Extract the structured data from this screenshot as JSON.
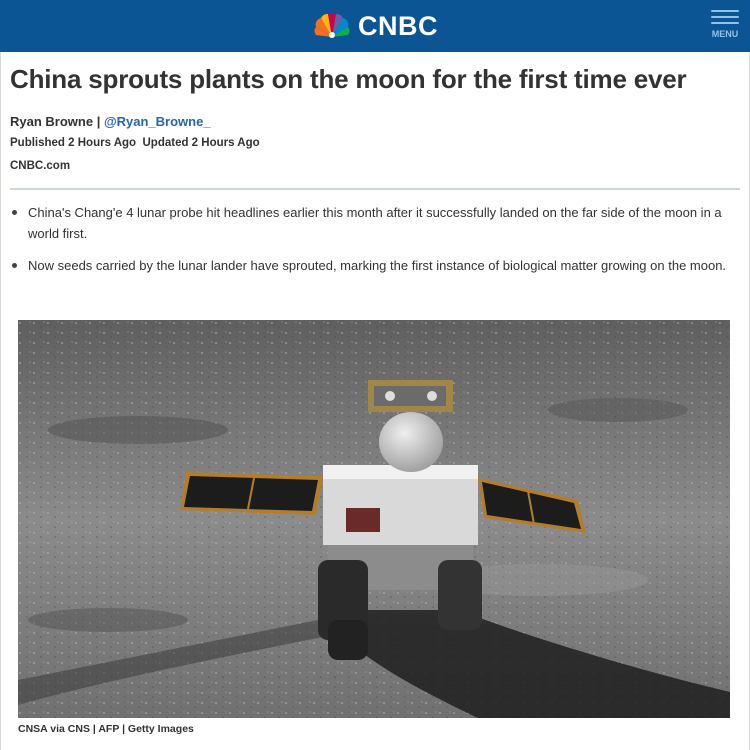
{
  "header": {
    "brand": "CNBC",
    "menu_label": "MENU",
    "background_color": "#0c5594"
  },
  "article": {
    "headline": "China sprouts plants on the moon for the first time ever",
    "author": "Ryan Browne",
    "separator": " | ",
    "twitter_handle": "@Ryan_Browne_",
    "published": "Published 2 Hours Ago",
    "updated": "Updated 2 Hours Ago",
    "source": "CNBC.com",
    "bullets": [
      "China's Chang'e 4 lunar probe hit headlines earlier this month after it successfully landed on the far side of the moon in a world first.",
      "Now seeds carried by the lunar lander have sprouted, marking the first instance of biological matter growing on the moon."
    ],
    "image_caption": "CNSA via CNS | AFP | Getty Images"
  }
}
